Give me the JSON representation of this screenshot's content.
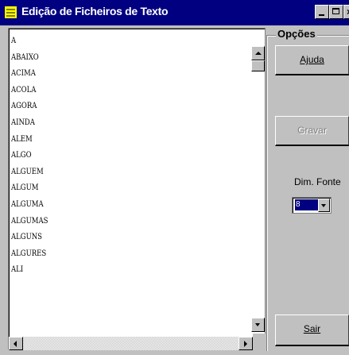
{
  "window": {
    "title": "Edição de Ficheiros de Texto"
  },
  "list": {
    "items": [
      "A",
      "ABAIXO",
      "ACIMA",
      "ACOLA",
      "AGORA",
      "AINDA",
      "ALEM",
      "ALGO",
      "ALGUEM",
      "ALGUM",
      "ALGUMA",
      "ALGUMAS",
      "ALGUNS",
      "ALGURES",
      "ALI"
    ]
  },
  "options": {
    "group_title": "Opções",
    "help_button": "Ajuda",
    "save_button": "Gravar",
    "font_size_label": "Dim. Fonte",
    "font_size_value": "8",
    "exit_button": "Sair"
  },
  "colors": {
    "titlebar": "#000080",
    "face": "#c0c0c0",
    "selection": "#000080"
  }
}
